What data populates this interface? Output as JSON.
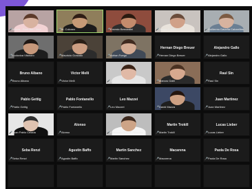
{
  "tiles": [
    {
      "label": "Moura · Para Bet / Verv",
      "mode": "video",
      "skin": "#d8b2a0",
      "hair": "#5c3a2a",
      "shirt": "#f2d2d4",
      "bg": "#b8a3a3"
    },
    {
      "label": "M. Colonez",
      "mode": "video",
      "skin": "#c69a76",
      "hair": "#2e1d15",
      "shirt": "#1b1b1b",
      "bg": "#8f7e5b",
      "active": true
    },
    {
      "label": "Ernesto Bernardini",
      "mode": "video",
      "skin": "#c38b6c",
      "hair": "#2a1a10",
      "shirt": "#2d2d2d",
      "bg": "#8e4c3d"
    },
    {
      "label": "Sergio Cappo",
      "mode": "video",
      "skin": "#d0a189",
      "hair": "#6a4c3b",
      "shirt": "#e9e3dc",
      "bg": "#c9c3bf"
    },
    {
      "label": "Guillermo Daveña Cabanilles",
      "mode": "video",
      "skin": "#d7b39f",
      "hair": "#7c5b43",
      "shirt": "#6b7f93",
      "bg": "#a8aeb2"
    },
    {
      "label": "Ludovica Vilanoro",
      "mode": "video",
      "skin": "#c7987b",
      "hair": "#1f1714",
      "shirt": "#1e1e1e",
      "bg": "#6e6e6e"
    },
    {
      "label": "Mauricio Gonzalo",
      "mode": "video",
      "skin": "#cc9e82",
      "hair": "#2a1f16",
      "shirt": "#2c2c2c",
      "bg": "#4b4238"
    },
    {
      "label": "Adrian Fuego",
      "mode": "video",
      "skin": "#d3ab93",
      "hair": "#3f2a1f",
      "shirt": "#404a57",
      "bg": "#7e7363"
    },
    {
      "name": "Hernan Diego Breuer",
      "label": "Hernan Diego Breuer",
      "mode": "name"
    },
    {
      "name": "Alejandro Gallo",
      "label": "Alejandro Gallo",
      "mode": "name"
    },
    {
      "name": "Bruno Albano",
      "label": "Bruno Albano",
      "mode": "name"
    },
    {
      "name": "Victor Melli",
      "label": "Victor Melli",
      "mode": "name"
    },
    {
      "label": "Valentina",
      "mode": "video",
      "skin": "#e0b9a6",
      "hair": "#3b2418",
      "shirt": "#e6e6e6",
      "bg": "#c9c9c9"
    },
    {
      "label": "Marcos Gatti",
      "mode": "video",
      "skin": "#d7a98f",
      "hair": "#4a3222",
      "shirt": "#2a2a2a",
      "bg": "#8a6d57"
    },
    {
      "name": "Raul Sin",
      "label": "Raul Sin",
      "mode": "name"
    },
    {
      "name": "Pablo Gettig",
      "label": "Pablo Gettig",
      "mode": "name"
    },
    {
      "name": "Pablo Fontanello",
      "label": "Pablo Fontanello",
      "mode": "name"
    },
    {
      "name": "Leo Mazzei",
      "label": "Leo Mazzei",
      "mode": "name"
    },
    {
      "label": "David Mazza",
      "mode": "video",
      "skin": "#cda083",
      "hair": "#24150e",
      "shirt": "#1f1f1f",
      "bg": "#3c4864"
    },
    {
      "name": "Juan Martinez",
      "label": "Juan Martinez",
      "mode": "name"
    },
    {
      "label": "Juan Pablo Celada",
      "mode": "video",
      "skin": "#dfc3b1",
      "hair": "#2f2f2f",
      "shirt": "#111111",
      "bg": "#e6e6e6"
    },
    {
      "name": "Alonso",
      "label": "Alonso",
      "mode": "name"
    },
    {
      "label": "Fernando Oriana / Mendez",
      "mode": "video",
      "skin": "#cda487",
      "hair": "#3c281d",
      "shirt": "#f5f5f5",
      "bg": "#bdbdbd"
    },
    {
      "name": "Martin Trokill",
      "label": "Martin Trokill",
      "mode": "name"
    },
    {
      "name": "Lucas Lieber",
      "label": "Lucas Lieber",
      "mode": "name"
    },
    {
      "name": "Seba Renzi",
      "label": "Seba Renzi",
      "mode": "name"
    },
    {
      "name": "Agustin Baffo",
      "label": "Agustin Baffo",
      "mode": "name"
    },
    {
      "name": "Martin Sanchez",
      "label": "Martin Sanchez",
      "mode": "name"
    },
    {
      "name": "Macarena",
      "label": "Macarena",
      "mode": "name"
    },
    {
      "name": "Paola De Rosa",
      "label": "Paola De Rosa",
      "mode": "name"
    },
    {
      "name": "",
      "label": "",
      "mode": "empty"
    },
    {
      "name": "",
      "label": "",
      "mode": "empty"
    },
    {
      "name": "",
      "label": "",
      "mode": "empty"
    },
    {
      "name": "",
      "label": "",
      "mode": "empty"
    },
    {
      "name": "",
      "label": "",
      "mode": "empty"
    }
  ],
  "mic_icon": "mic-muted-icon"
}
